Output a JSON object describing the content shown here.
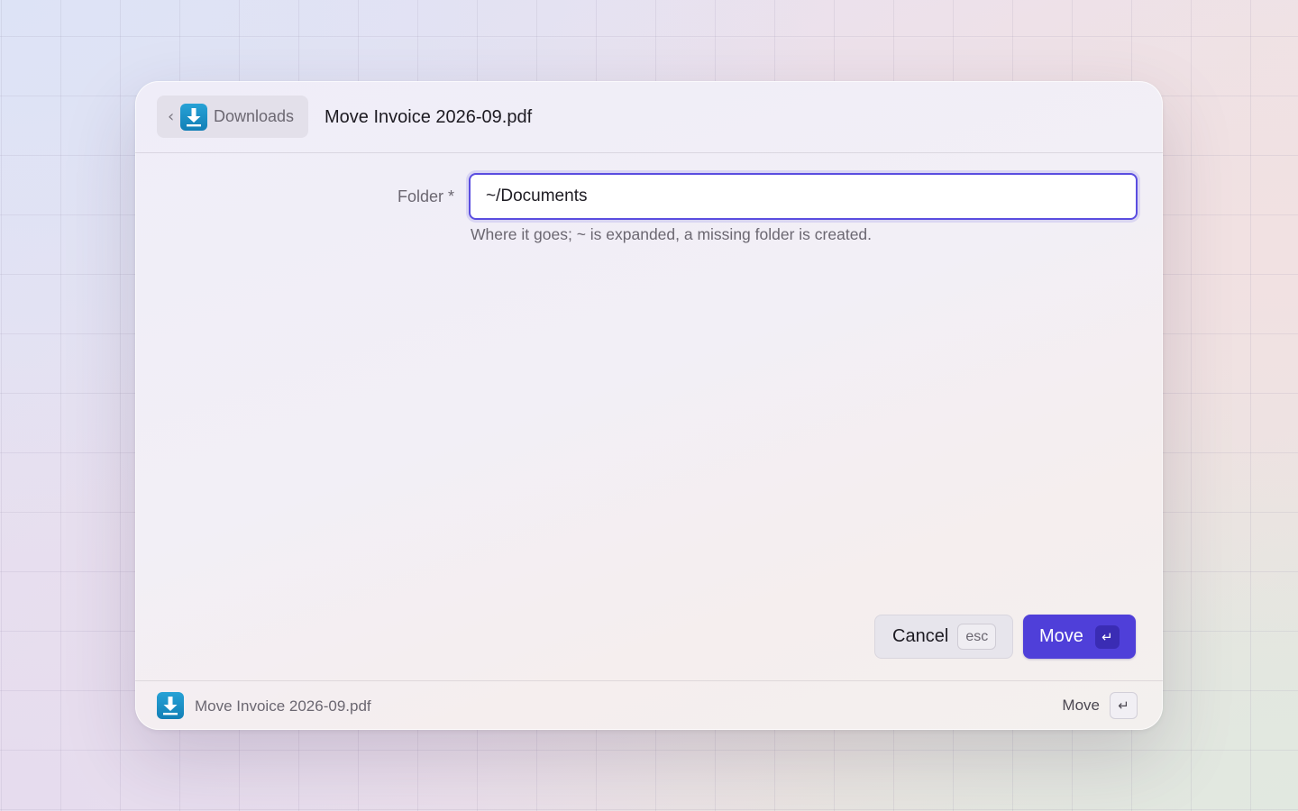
{
  "header": {
    "back_label": "Downloads",
    "back_chevron": "‹",
    "app_icon": "download-icon",
    "title": "Move Invoice 2026-09.pdf"
  },
  "form": {
    "folder_label": "Folder *",
    "folder_value": "~/Documents",
    "folder_hint": "Where it goes; ~ is expanded, a missing folder is created."
  },
  "actions": {
    "cancel_label": "Cancel",
    "cancel_shortcut": "esc",
    "move_label": "Move",
    "move_shortcut": "↵"
  },
  "footer": {
    "title": "Move Invoice 2026-09.pdf",
    "action_label": "Move",
    "action_shortcut": "↵"
  },
  "colors": {
    "accent": "#4f3fd9",
    "app_icon": "#1a8fc6"
  }
}
